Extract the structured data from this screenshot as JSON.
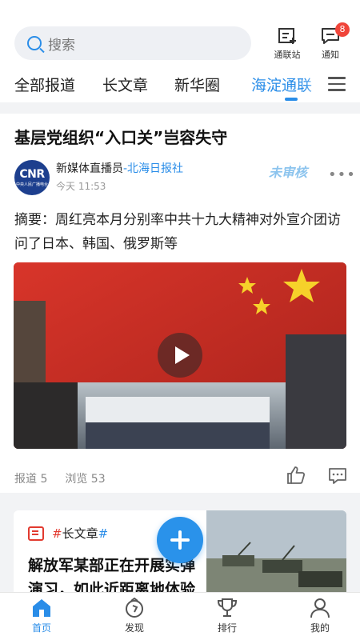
{
  "search": {
    "placeholder": "搜索"
  },
  "header_buttons": [
    {
      "label": "通联站",
      "icon": "edit-icon"
    },
    {
      "label": "通知",
      "icon": "message-icon",
      "badge": "8"
    }
  ],
  "tabs": [
    {
      "label": "全部报道",
      "active": false
    },
    {
      "label": "长文章",
      "active": false
    },
    {
      "label": "新华圈",
      "active": false
    },
    {
      "label": "海淀通联",
      "active": true
    }
  ],
  "article": {
    "title": "基层党组织“入口关”岂容失守",
    "source_name": "新媒体直播员",
    "source_org": "-北海日报社",
    "time": "今天 11:53",
    "stamp": "未审核",
    "summary": "摘要：周红亮本月分别率中共十九大精神对外宣介团访问了日本、韩国、俄罗斯等",
    "avatar_text": "CNR",
    "avatar_sub": "中央人民广播电台",
    "reports": "报道 5",
    "views": "浏览 53"
  },
  "card2": {
    "tag_hash": "#",
    "tag_label": "长文章",
    "tag_hash_end": "#",
    "title": "解放军某部正在开展实弹演习，如此近距离地体验"
  },
  "bottom_nav": [
    {
      "label": "首页",
      "icon": "home-icon",
      "active": true
    },
    {
      "label": "发现",
      "icon": "compass-icon",
      "active": false
    },
    {
      "label": "排行",
      "icon": "trophy-icon",
      "active": false
    },
    {
      "label": "我的",
      "icon": "user-icon",
      "active": false
    }
  ],
  "colors": {
    "accent": "#2a8de8",
    "badge": "#f0453a",
    "tag": "#e23a2f"
  }
}
